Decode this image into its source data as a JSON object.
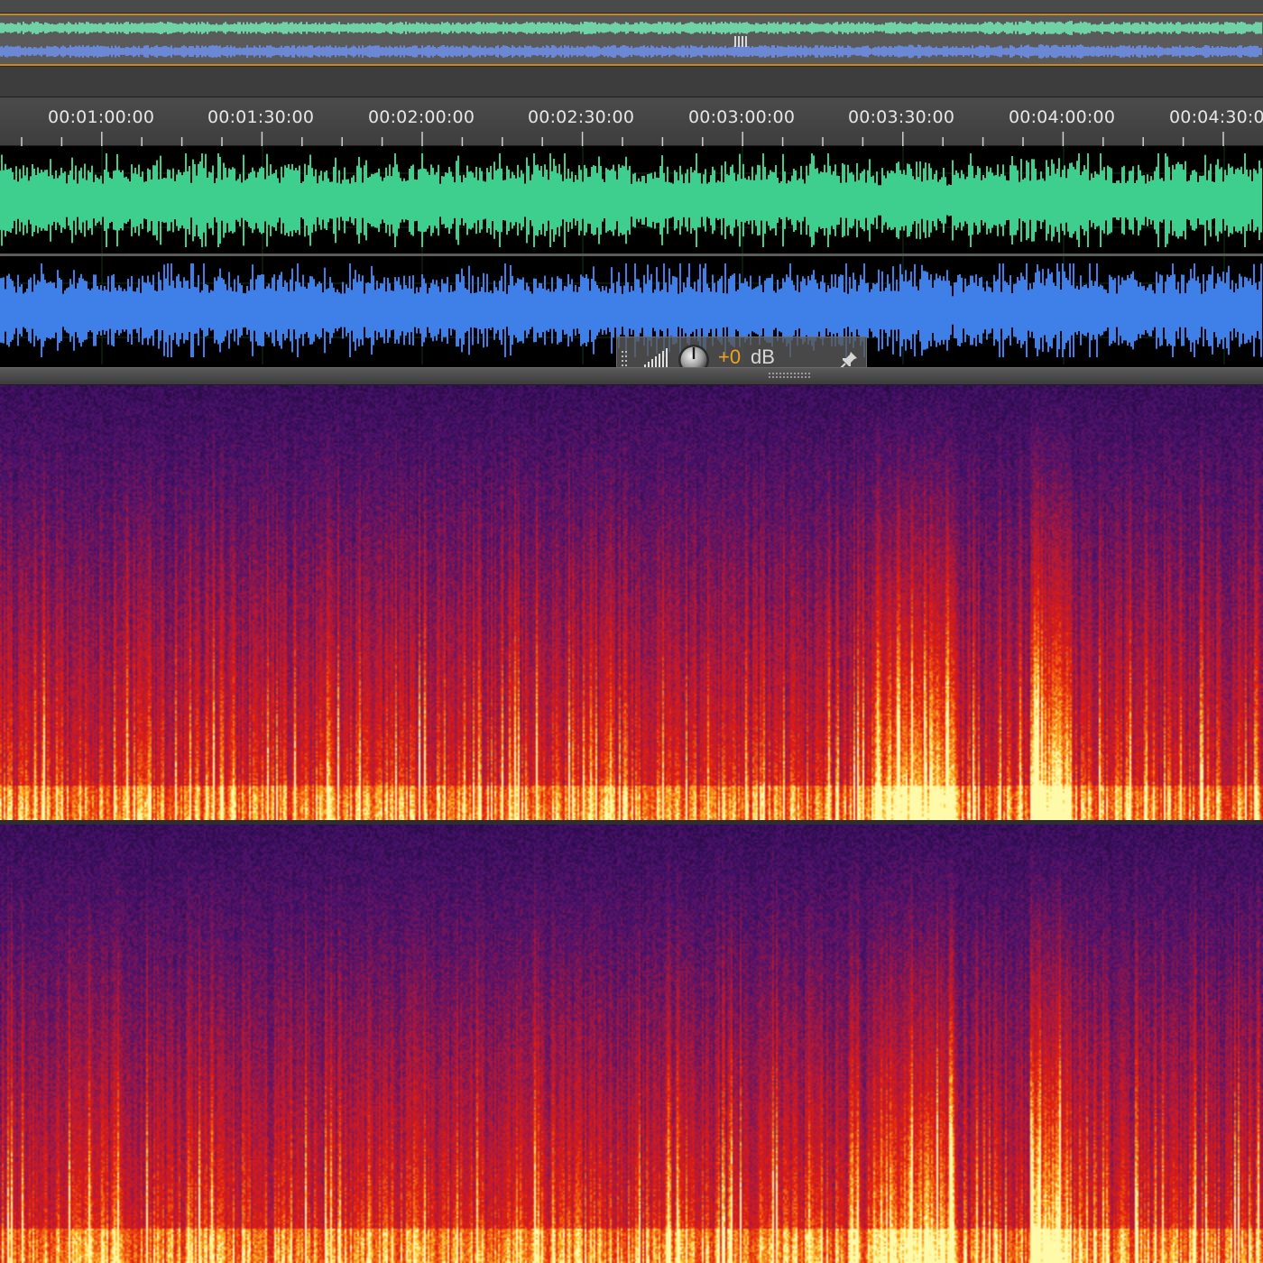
{
  "timeline": {
    "ticks": [
      "00:01:00:00",
      "00:01:30:00",
      "00:02:00:00",
      "00:02:30:00",
      "00:03:00:00",
      "00:03:30:00",
      "00:04:00:00",
      "00:04:30:00"
    ]
  },
  "hud": {
    "gain_value": "+0",
    "gain_unit": "dB"
  },
  "channels": [
    {
      "id": "left",
      "color": "#3ecf8e"
    },
    {
      "id": "right",
      "color": "#3f7fe8"
    }
  ],
  "overview_colors": {
    "left": "#6fd3a6",
    "right": "#6a88d6",
    "border": "#c8891c"
  },
  "icons": [
    "grip-icon",
    "level-meter-icon",
    "volume-knob-icon",
    "pin-icon",
    "splitter-handle-icon"
  ]
}
